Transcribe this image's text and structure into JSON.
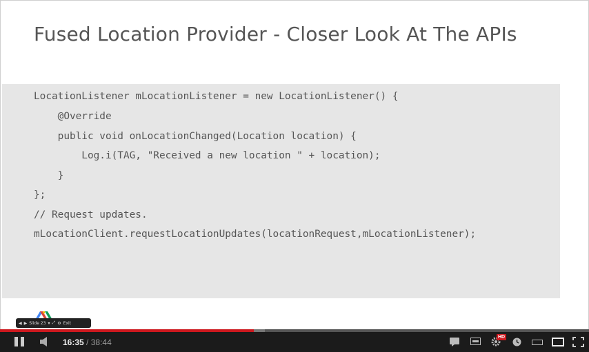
{
  "slide": {
    "title": "Fused Location Provider - Closer Look At The APIs",
    "code_lines": [
      "LocationListener mLocationListener = new LocationListener() {",
      "    @Override",
      "    public void onLocationChanged(Location location) {",
      "        Log.i(TAG, \"Received a new location \" + location);",
      "    }",
      "};",
      "// Request updates.",
      "mLocationClient.requestLocationUpdates(locationRequest,mLocationListener);"
    ]
  },
  "slide_nav": {
    "slide_label": "Slide 23",
    "exit_label": "Exit"
  },
  "player": {
    "current_time": "16:35",
    "separator": " / ",
    "total_time": "38:44",
    "hd_badge": "HD",
    "progress_played": 0.431,
    "progress_buffered": 0.45,
    "colors": {
      "played": "#cc181e",
      "bar_bg": "#1b1b1b"
    },
    "icons": [
      "pause-icon",
      "volume-icon",
      "captions-icon",
      "transcript-icon",
      "settings-icon",
      "watch-later-icon",
      "small-player-icon",
      "large-player-icon",
      "fullscreen-icon"
    ]
  }
}
